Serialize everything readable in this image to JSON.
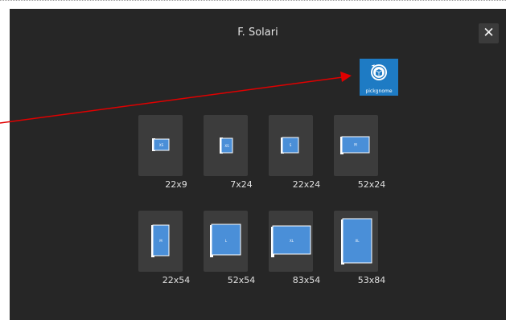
{
  "dialog": {
    "title": "F. Solari",
    "close_label": "✕"
  },
  "logo": {
    "label": "pickgnome",
    "icon": "pickgnome-box-icon",
    "color": "#1e7bc4"
  },
  "sizes": [
    {
      "label": "22x9",
      "badge": "XS"
    },
    {
      "label": "7x24",
      "badge": "XS"
    },
    {
      "label": "22x24",
      "badge": "S"
    },
    {
      "label": "52x24",
      "badge": "M"
    },
    {
      "label": "22x54",
      "badge": "M"
    },
    {
      "label": "52x54",
      "badge": "L"
    },
    {
      "label": "83x54",
      "badge": "XL"
    },
    {
      "label": "53x84",
      "badge": "XL"
    }
  ],
  "annotation": {
    "type": "arrow",
    "color": "#e00000"
  },
  "colors": {
    "book": "#4a8fd8",
    "tile": "#3c3c3c",
    "background": "#262626"
  }
}
